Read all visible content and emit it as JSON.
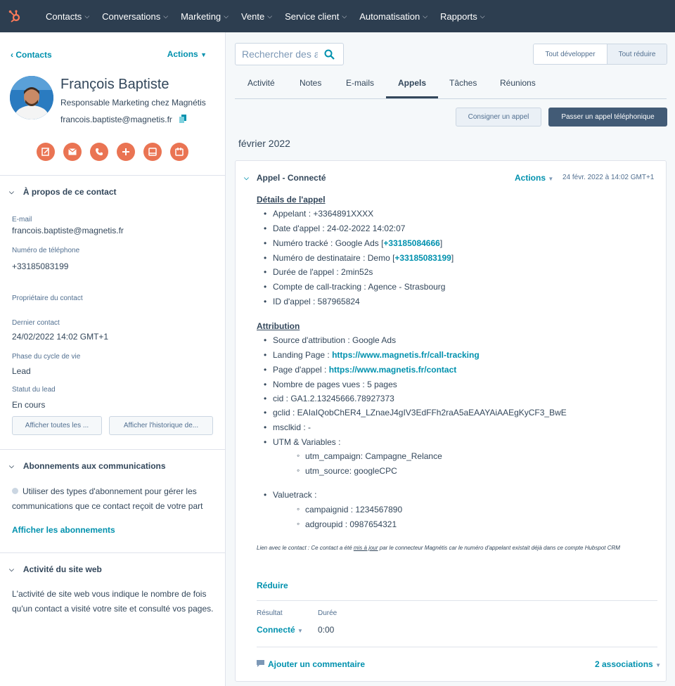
{
  "nav": {
    "items": [
      {
        "label": "Contacts"
      },
      {
        "label": "Conversations"
      },
      {
        "label": "Marketing"
      },
      {
        "label": "Vente"
      },
      {
        "label": "Service client"
      },
      {
        "label": "Automatisation"
      },
      {
        "label": "Rapports"
      }
    ]
  },
  "sidebar": {
    "back_label": "Contacts",
    "actions_label": "Actions",
    "contact": {
      "name": "François Baptiste",
      "title": "Responsable Marketing chez Magnétis",
      "email": "francois.baptiste@magnetis.fr"
    },
    "about": {
      "heading": "À propos de ce contact",
      "email_label": "E-mail",
      "email_value": "francois.baptiste@magnetis.fr",
      "phone_label": "Numéro de téléphone",
      "phone_value": "+33185083199",
      "owner_label": "Propriétaire du contact",
      "last_contact_label": "Dernier contact",
      "last_contact_value": "24/02/2022 14:02 GMT+1",
      "lifecycle_label": "Phase du cycle de vie",
      "lifecycle_value": "Lead",
      "lead_status_label": "Statut du lead",
      "lead_status_value": "En cours",
      "view_all_label": "Afficher toutes les ...",
      "view_history_label": "Afficher l'historique de..."
    },
    "subscriptions": {
      "heading": "Abonnements aux communications",
      "text": "Utiliser des types d'abonnement pour gérer les communications que ce contact reçoit de votre part",
      "link": "Afficher les abonnements"
    },
    "web_activity": {
      "heading": "Activité du site web",
      "text": "L'activité de site web vous indique le nombre de fois qu'un contact a visité votre site et consulté vos pages."
    }
  },
  "main": {
    "search_placeholder": "Rechercher des acti",
    "expand_all": "Tout développer",
    "collapse_all": "Tout réduire",
    "tabs": [
      {
        "label": "Activité"
      },
      {
        "label": "Notes"
      },
      {
        "label": "E-mails"
      },
      {
        "label": "Appels"
      },
      {
        "label": "Tâches"
      },
      {
        "label": "Réunions"
      }
    ],
    "log_call": "Consigner un appel",
    "make_call": "Passer un appel téléphonique",
    "month": "février 2022",
    "call": {
      "title": "Appel - Connecté",
      "actions": "Actions",
      "date": "24 févr. 2022 à 14:02 GMT+1",
      "details_heading": "Détails de l'appel",
      "details": {
        "caller": "Appelant : +3364891XXXX",
        "date": "Date d'appel : 24-02-2022 14:02:07",
        "tracked_prefix": "Numéro tracké : Google Ads [",
        "tracked_number": "+33185084666",
        "dest_prefix": "Numéro de destinataire : Demo [",
        "dest_number": "+33185083199",
        "close_bracket": "]",
        "duration": "Durée de l'appel : 2min52s",
        "account": "Compte de call-tracking : Agence - Strasbourg",
        "call_id": "ID d'appel : 587965824"
      },
      "attribution_heading": "Attribution",
      "attribution": {
        "source": "Source d'attribution : Google Ads",
        "landing_prefix": "Landing Page : ",
        "landing_url": "https://www.magnetis.fr/call-tracking",
        "call_page_prefix": "Page d'appel : ",
        "call_page_url": "https://www.magnetis.fr/contact",
        "pages_viewed": "Nombre de pages vues : 5 pages",
        "cid": "cid : GA1.2.13245666.78927373",
        "gclid": "gclid : EAIaIQobChER4_LZnaeJ4gIV3EdFFh2raA5aEAAYAiAAEgKyCF3_BwE",
        "msclkid": "msclkid : -",
        "utm_heading": "UTM & Variables :",
        "utm_campaign": "utm_campaign: Campagne_Relance",
        "utm_source": "utm_source: googleCPC",
        "valuetrack_heading": "Valuetrack :",
        "campaignid": "campaignid : 1234567890",
        "adgroupid": "adgroupid : 0987654321"
      },
      "note_before": "Lien avec le contact : Ce contact a été ",
      "note_link": "mis à jour",
      "note_after": " par le connecteur Magnétis car le numéro d'appelant existait déjà dans ce compte Hubspot CRM",
      "reduce": "Réduire",
      "result_label": "Résultat",
      "duration_label": "Durée",
      "result_value": "Connecté",
      "duration_value": "0:00",
      "add_comment": "Ajouter un commentaire",
      "associations": "2 associations"
    }
  },
  "colors": {
    "nav_bg": "#2d3e50",
    "accent_orange": "#ff7a59",
    "action_orange": "#ea7453",
    "link_blue": "#0091ae",
    "primary_button": "#425b76"
  },
  "icons": {
    "logo": "hubspot-sprocket-icon",
    "action_buttons": [
      "note-icon",
      "email-icon",
      "phone-icon",
      "plus-icon",
      "task-icon",
      "meeting-icon"
    ]
  }
}
